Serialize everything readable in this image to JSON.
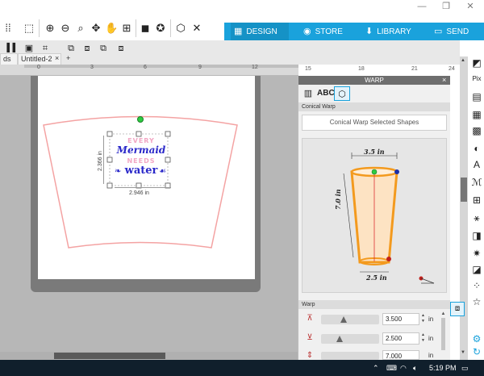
{
  "window": {
    "minimize": "—",
    "restore": "❐",
    "close": "✕"
  },
  "nav": {
    "tabs": [
      {
        "label": "DESIGN",
        "icon": "grid-icon"
      },
      {
        "label": "STORE",
        "icon": "store-icon"
      },
      {
        "label": "LIBRARY",
        "icon": "library-icon"
      },
      {
        "label": "SEND",
        "icon": "send-icon"
      }
    ],
    "active": "DESIGN"
  },
  "documents": {
    "tabs": [
      "ds",
      "Untitled-2"
    ],
    "close": "×",
    "add": "+"
  },
  "ruler": {
    "marks": [
      "0",
      "3",
      "6",
      "9",
      "12",
      "15",
      "18",
      "21",
      "24"
    ]
  },
  "design": {
    "lines": [
      "EVERY",
      "Mermaid",
      "NEEDS",
      "water"
    ],
    "width_label": "2.946 in",
    "height_label": "2.366 in",
    "colors": {
      "pink": "#f2a7c4",
      "blue": "#2a28c9",
      "outline": "#f4a3a3"
    }
  },
  "warp_panel": {
    "title": "WARP",
    "close": "×",
    "section_conical": "Conical Warp",
    "apply_button": "Conical Warp Selected Shapes",
    "preview": {
      "top_width": "3.5 in",
      "height": "7.0 in",
      "bottom_width": "2.5 in"
    },
    "section_warp": "Warp",
    "params": [
      {
        "value": "3.500",
        "unit": "in"
      },
      {
        "value": "2.500",
        "unit": "in"
      },
      {
        "value": "7.000",
        "unit": "in"
      }
    ],
    "spin_up": "▲",
    "spin_down": "▼"
  },
  "taskbar": {
    "time": "5:19 PM"
  },
  "accent": "#1aa2dc"
}
